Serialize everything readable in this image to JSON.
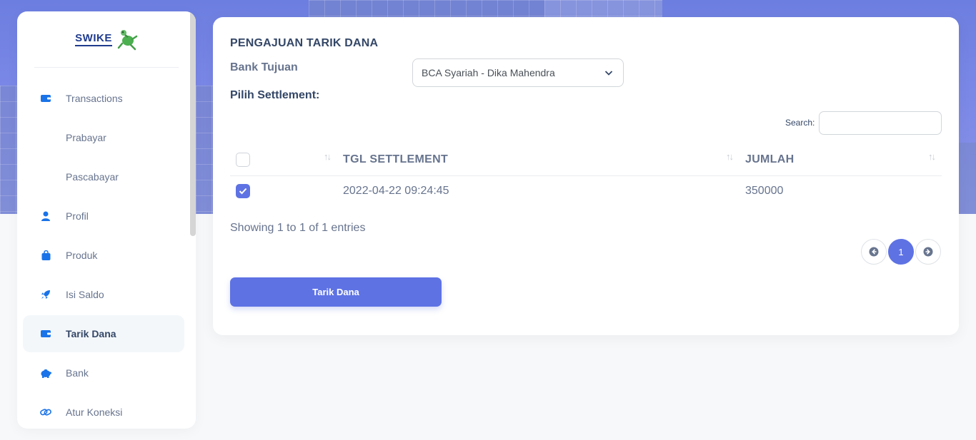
{
  "brand": {
    "name": "SWIKE"
  },
  "sidebar": {
    "items": [
      {
        "label": "Transactions",
        "icon": "wallet-icon"
      },
      {
        "label": "Prabayar",
        "icon": ""
      },
      {
        "label": "Pascabayar",
        "icon": ""
      },
      {
        "label": "Profil",
        "icon": "user-icon"
      },
      {
        "label": "Produk",
        "icon": "bag-icon"
      },
      {
        "label": "Isi Saldo",
        "icon": "rocket-icon"
      },
      {
        "label": "Tarik Dana",
        "icon": "wallet-icon",
        "active": true
      },
      {
        "label": "Bank",
        "icon": "piggy-bank-icon"
      },
      {
        "label": "Atur Koneksi",
        "icon": "link-icon"
      }
    ]
  },
  "form": {
    "title": "PENGAJUAN TARIK DANA",
    "bank_label": "Bank Tujuan",
    "bank_value": "BCA Syariah - Dika Mahendra",
    "settlement_label": "Pilih Settlement:",
    "search_label": "Search:",
    "search_value": ""
  },
  "table": {
    "headers": [
      "",
      "TGL SETTLEMENT",
      "JUMLAH"
    ],
    "rows": [
      {
        "checked": true,
        "tgl": "2022-04-22 09:24:45",
        "jumlah": "350000"
      }
    ],
    "info": "Showing 1 to 1 of 1 entries"
  },
  "pagination": {
    "current": "1"
  },
  "actions": {
    "submit_label": "Tarik Dana"
  },
  "colors": {
    "primary": "#5e72e4",
    "text": "#344767",
    "muted": "#67748e",
    "icon_blue": "#1a73e8"
  }
}
